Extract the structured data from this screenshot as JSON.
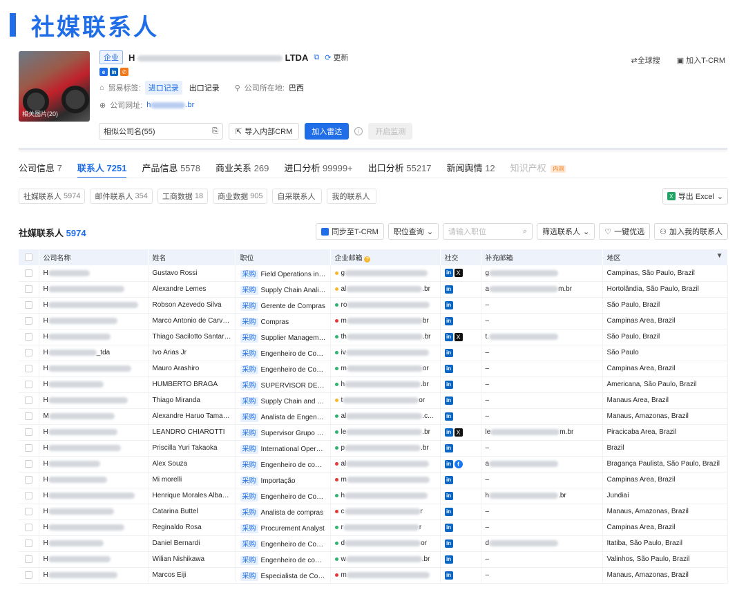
{
  "banner": {
    "title": "社媒联系人",
    "color": "#1f6ee8"
  },
  "company": {
    "type_tag": "企业",
    "name_prefix": "H",
    "name_suffix": "LTDA",
    "update_label": "更新",
    "photo_caption": "相关图片(20)",
    "trade_tag_label": "贸易标签:",
    "import_tag": "进口记录",
    "export_tag": "出口记录",
    "location_label": "公司所在地:",
    "location_value": "巴西",
    "website_label": "公司网址:",
    "website_prefix": "h",
    "website_suffix": ".br"
  },
  "top_actions": {
    "global_search": "全球搜",
    "add_tcrm": "加入T-CRM"
  },
  "actions": {
    "similar": "相似公司名(55)",
    "import_crm": "导入内部CRM",
    "add_radar": "加入雷达",
    "monitor": "开启监测"
  },
  "tabs": [
    {
      "label": "公司信息",
      "count": "7",
      "active": false
    },
    {
      "label": "联系人",
      "count": "7251",
      "active": true
    },
    {
      "label": "产品信息",
      "count": "5578",
      "active": false
    },
    {
      "label": "商业关系",
      "count": "269",
      "active": false
    },
    {
      "label": "进口分析",
      "count": "99999+",
      "active": false
    },
    {
      "label": "出口分析",
      "count": "55217",
      "active": false
    },
    {
      "label": "新闻舆情",
      "count": "12",
      "active": false
    },
    {
      "label": "知识产权",
      "count": "",
      "active": false,
      "badge": "内测"
    }
  ],
  "filters": [
    {
      "label": "社媒联系人",
      "count": "5974"
    },
    {
      "label": "邮件联系人",
      "count": "354"
    },
    {
      "label": "工商数据",
      "count": "18"
    },
    {
      "label": "商业数据",
      "count": "905"
    },
    {
      "label": "自采联系人",
      "count": ""
    },
    {
      "label": "我的联系人",
      "count": ""
    }
  ],
  "export_label": "导出 Excel",
  "section": {
    "title": "社媒联系人",
    "count": "5974"
  },
  "toolbar": {
    "sync": "同步至T-CRM",
    "position_query": "职位查询",
    "position_placeholder": "请输入职位",
    "filter_contacts": "筛选联系人",
    "one_click": "一键优选",
    "add_mine": "加入我的联系人"
  },
  "columns": [
    "公司名称",
    "姓名",
    "职位",
    "企业邮箱",
    "社交",
    "补充邮箱",
    "地区"
  ],
  "category_tag": "采购",
  "rows": [
    {
      "co": "H",
      "co_end": "",
      "name": "Gustavo Rossi",
      "pos": "Field Operations in A...",
      "dot": "#f5b82e",
      "em_s": "g",
      "em_e": "",
      "soc": [
        "li",
        "x"
      ],
      "sup_s": "g",
      "sup_e": "",
      "region": "Campinas, São Paulo, Brazil"
    },
    {
      "co": "H",
      "co_end": "",
      "name": "Alexandre Lemes",
      "pos": "Supply Chain Analist ...",
      "dot": "#f5b82e",
      "em_s": "al",
      "em_e": ".br",
      "soc": [
        "li"
      ],
      "sup_s": "a",
      "sup_e": "m.br",
      "region": "Hortolândia, São Paulo, Brazil"
    },
    {
      "co": "H",
      "co_end": "",
      "name": "Robson Azevedo Silva",
      "pos": "Gerente de Compras",
      "dot": "#2fb36f",
      "em_s": "ro",
      "em_e": "",
      "soc": [
        "li"
      ],
      "sup_s": "–",
      "sup_e": "",
      "region": "São Paulo, Brazil"
    },
    {
      "co": "H",
      "co_end": "",
      "name": "Marco Antonio de Carvalho",
      "pos": "Compras",
      "dot": "#e53935",
      "em_s": "m",
      "em_e": "br",
      "soc": [
        "li"
      ],
      "sup_s": "–",
      "sup_e": "",
      "region": "Campinas Area, Brazil"
    },
    {
      "co": "H",
      "co_end": "",
      "name": "Thiago Sacilotto Santarosa",
      "pos": "Supplier Managemen...",
      "dot": "#2fb36f",
      "em_s": "th",
      "em_e": ".br",
      "soc": [
        "li",
        "x"
      ],
      "sup_s": "t.",
      "sup_e": "",
      "region": "São Paulo, Brazil"
    },
    {
      "co": "H",
      "co_end": "_tda",
      "name": "Ivo Arias Jr",
      "pos": "Engenheiro de Comp...",
      "dot": "#2fb36f",
      "em_s": "iv",
      "em_e": "",
      "soc": [
        "li"
      ],
      "sup_s": "–",
      "sup_e": "",
      "region": "São Paulo"
    },
    {
      "co": "H",
      "co_end": "",
      "name": "Mauro Arashiro",
      "pos": "Engenheiro de Comp...",
      "dot": "#2fb36f",
      "em_s": "m",
      "em_e": "or",
      "soc": [
        "li"
      ],
      "sup_s": "–",
      "sup_e": "",
      "region": "Campinas Area, Brazil"
    },
    {
      "co": "H",
      "co_end": "",
      "name": "HUMBERTO BRAGA",
      "pos": "SUPERVISOR DE CO...",
      "dot": "#2fb36f",
      "em_s": "h",
      "em_e": ".br",
      "soc": [
        "li"
      ],
      "sup_s": "–",
      "sup_e": "",
      "region": "Americana, São Paulo, Brazil"
    },
    {
      "co": "H",
      "co_end": "",
      "name": "Thiago Miranda",
      "pos": "Supply Chain and Lo...",
      "dot": "#f5b82e",
      "em_s": "t",
      "em_e": "or",
      "soc": [
        "li"
      ],
      "sup_s": "–",
      "sup_e": "",
      "region": "Manaus Area, Brazil"
    },
    {
      "co": "M",
      "co_end": "",
      "name": "Alexandre Haruo Tamaga...",
      "pos": "Analista de Engenhar...",
      "dot": "#2fb36f",
      "em_s": "al",
      "em_e": ".c...",
      "soc": [
        "li"
      ],
      "sup_s": "–",
      "sup_e": "",
      "region": "Manaus, Amazonas, Brazil"
    },
    {
      "co": "H",
      "co_end": "",
      "name": "LEANDRO CHIAROTTI",
      "pos": "Supervisor Grupo Qu...",
      "dot": "#2fb36f",
      "em_s": "le",
      "em_e": ".br",
      "soc": [
        "li",
        "x"
      ],
      "sup_s": "le",
      "sup_e": "m.br",
      "region": "Piracicaba Area, Brazil"
    },
    {
      "co": "H",
      "co_end": "",
      "name": "Priscilla Yuri Takaoka",
      "pos": "International Operati...",
      "dot": "#2fb36f",
      "em_s": "p",
      "em_e": ".br",
      "soc": [
        "li"
      ],
      "sup_s": "–",
      "sup_e": "",
      "region": "Brazil"
    },
    {
      "co": "H",
      "co_end": "",
      "name": "Alex Souza",
      "pos": "Engenheiro de compras",
      "dot": "#e53935",
      "em_s": "al",
      "em_e": "",
      "soc": [
        "li",
        "fb"
      ],
      "sup_s": "a",
      "sup_e": "",
      "region": "Bragança Paulista, São Paulo, Brazil"
    },
    {
      "co": "H",
      "co_end": "",
      "name": "Mi morelli",
      "pos": "Importação",
      "dot": "#e53935",
      "em_s": "m",
      "em_e": "",
      "soc": [
        "li"
      ],
      "sup_s": "–",
      "sup_e": "",
      "region": "Campinas Area, Brazil"
    },
    {
      "co": "H",
      "co_end": "",
      "name": "Henrique Morales Albacete",
      "pos": "Engenheiro de Comp...",
      "dot": "#2fb36f",
      "em_s": "h",
      "em_e": "",
      "soc": [
        "li"
      ],
      "sup_s": "h",
      "sup_e": ".br",
      "region": "Jundiaí"
    },
    {
      "co": "H",
      "co_end": "",
      "name": "Catarina Buttel",
      "pos": "Analista de compras",
      "dot": "#e53935",
      "em_s": "c",
      "em_e": "r",
      "soc": [
        "li"
      ],
      "sup_s": "–",
      "sup_e": "",
      "region": "Manaus, Amazonas, Brazil"
    },
    {
      "co": "H",
      "co_end": "",
      "name": "Reginaldo Rosa",
      "pos": "Procurement Analyst",
      "dot": "#2fb36f",
      "em_s": "r",
      "em_e": "r",
      "soc": [
        "li"
      ],
      "sup_s": "–",
      "sup_e": "",
      "region": "Campinas Area, Brazil"
    },
    {
      "co": "H",
      "co_end": "",
      "name": "Daniel Bernardi",
      "pos": "Engenheiro de Comp...",
      "dot": "#2fb36f",
      "em_s": "d",
      "em_e": "or",
      "soc": [
        "li"
      ],
      "sup_s": "d",
      "sup_e": "",
      "region": "Itatiba, São Paulo, Brazil"
    },
    {
      "co": "H",
      "co_end": "",
      "name": "Wilian Nishikawa",
      "pos": "Engenheiro de compr...",
      "dot": "#2fb36f",
      "em_s": "w",
      "em_e": ".br",
      "soc": [
        "li"
      ],
      "sup_s": "–",
      "sup_e": "",
      "region": "Valinhos, São Paulo, Brazil"
    },
    {
      "co": "H",
      "co_end": "",
      "name": "Marcos Eiji",
      "pos": "Especialista de Com...",
      "dot": "#e53935",
      "em_s": "m",
      "em_e": "",
      "soc": [
        "li"
      ],
      "sup_s": "–",
      "sup_e": "",
      "region": "Manaus, Amazonas, Brazil"
    }
  ]
}
